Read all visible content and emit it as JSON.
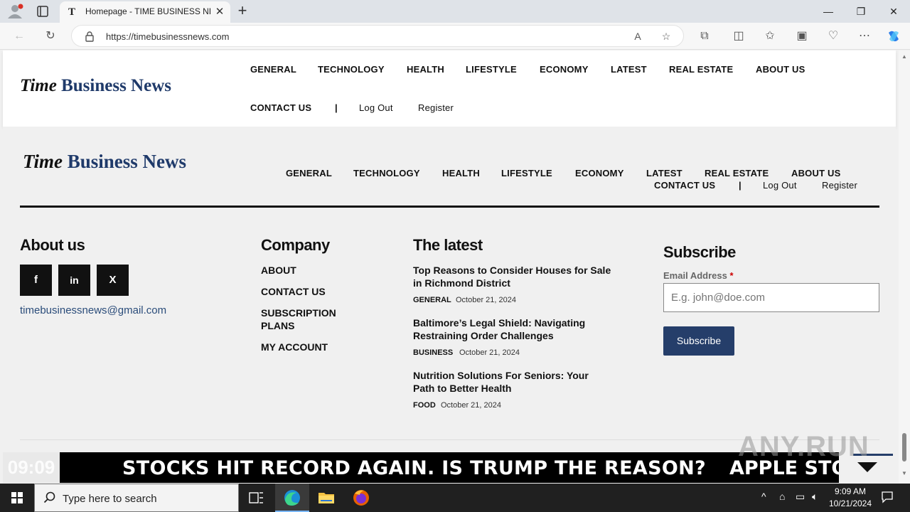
{
  "browser": {
    "tab_title": "Homepage - TIME BUSINESS NEWS",
    "tab_favicon": "T",
    "url": "https://timebusinessnews.com"
  },
  "site": {
    "logo_time": "Time",
    "logo_rest": "Business News",
    "nav": [
      "GENERAL",
      "TECHNOLOGY",
      "HEALTH",
      "LIFESTYLE",
      "ECONOMY",
      "LATEST",
      "REAL ESTATE",
      "ABOUT US"
    ],
    "nav2": [
      "CONTACT US",
      "|",
      "Log Out",
      "Register"
    ]
  },
  "footer": {
    "about": {
      "title": "About us",
      "socials": [
        "f",
        "in",
        "X"
      ],
      "email": "timebusinessnews@gmail.com"
    },
    "company": {
      "title": "Company",
      "links": [
        "ABOUT",
        "CONTACT US",
        "SUBSCRIPTION PLANS",
        "MY ACCOUNT"
      ]
    },
    "latest": {
      "title": "The latest",
      "posts": [
        {
          "title": "Top Reasons to Consider Houses for Sale in Richmond District",
          "category": "GENERAL",
          "date": "October 21, 2024"
        },
        {
          "title": "Baltimore’s Legal Shield: Navigating Restraining Order Challenges",
          "category": "BUSINESS",
          "date": "October 21, 2024"
        },
        {
          "title": "Nutrition Solutions For Seniors: Your Path to Better Health",
          "category": "FOOD",
          "date": "October 21, 2024"
        }
      ]
    },
    "subscribe": {
      "title": "Subscribe",
      "label": "Email Address",
      "required_mark": "*",
      "placeholder": "E.g. john@doe.com",
      "button": "Subscribe"
    }
  },
  "ticker": {
    "clock": "09:09",
    "headline": "STOCKS HIT RECORD AGAIN. IS TRUMP THE REASON?",
    "headline2": "APPLE STOC"
  },
  "watermark": "ANY.RUN",
  "taskbar": {
    "search_placeholder": "Type here to search",
    "time": "9:09 AM",
    "date": "10/21/2024"
  }
}
